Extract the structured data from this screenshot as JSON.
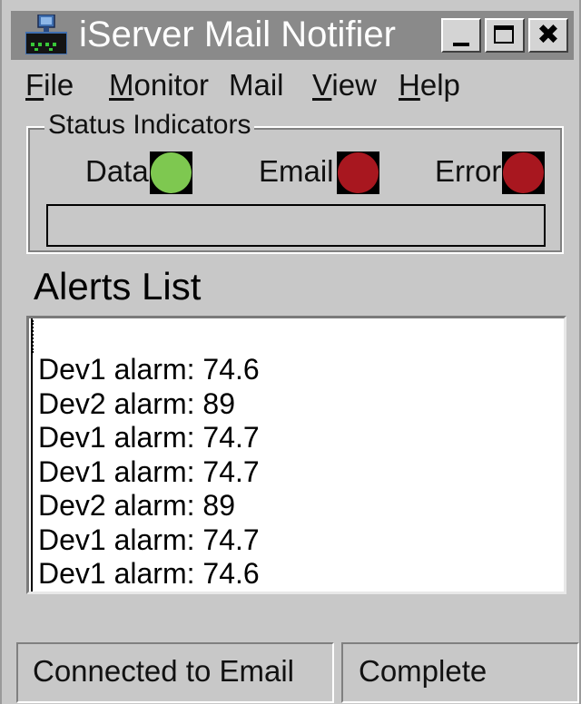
{
  "window": {
    "title": "iServer Mail Notifier",
    "icon": "iserver-app-icon",
    "controls": {
      "minimize": "minimize-icon",
      "maximize": "maximize-icon",
      "close": "✖"
    }
  },
  "menu": {
    "file": {
      "mnemonic": "F",
      "rest": "ile"
    },
    "monitor": {
      "mnemonic": "M",
      "rest": "onitor"
    },
    "mail": {
      "label": "Mail"
    },
    "view": {
      "mnemonic": "V",
      "rest": "iew"
    },
    "help": {
      "mnemonic": "H",
      "rest": "elp"
    }
  },
  "status_indicators": {
    "title": "Status Indicators",
    "items": [
      {
        "label": "Data",
        "state": "on",
        "color": "#7ec850"
      },
      {
        "label": "Email",
        "state": "off",
        "color": "#a8171f"
      },
      {
        "label": "Error",
        "state": "off",
        "color": "#a8171f"
      }
    ],
    "message": ""
  },
  "alerts": {
    "title": "Alerts List",
    "items": [
      "Dev1 alarm: 74.6",
      "Dev2 alarm: 89",
      "Dev1 alarm: 74.7",
      "Dev1 alarm: 74.7",
      "Dev2 alarm: 89",
      "Dev1 alarm: 74.7",
      "Dev1 alarm: 74.6"
    ]
  },
  "statusbar": {
    "connection": "Connected to Email",
    "progress": "Complete"
  }
}
